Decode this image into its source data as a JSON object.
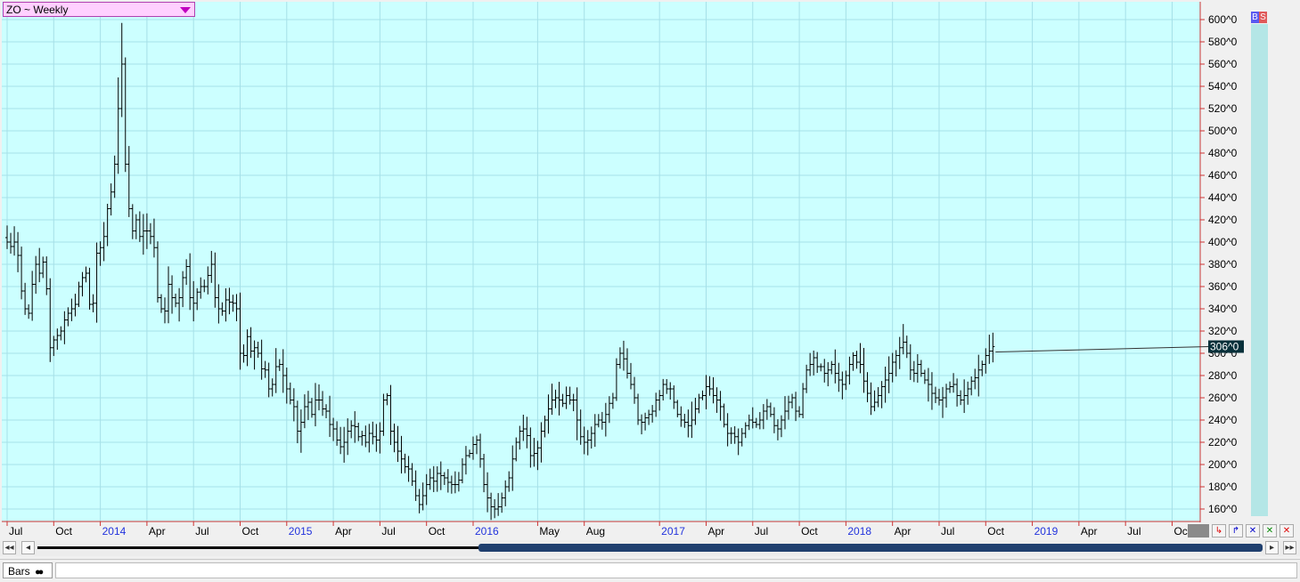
{
  "header": {
    "symbol_label": "ZO ~ Weekly"
  },
  "buttons": {
    "buy": "B",
    "sell": "S"
  },
  "bottom": {
    "study_tab": "Bars"
  },
  "colors": {
    "plot_bg": "#ccffff",
    "grid": "#a6e0e8",
    "axis": "#cc3333",
    "bar": "#000000",
    "price_tag_bg": "#08303a",
    "right_strip": "#b4e6e6",
    "year_label": "#2233dd"
  },
  "chart_data": {
    "type": "ohlc_bar",
    "title": "ZO ~ Weekly",
    "ylim": [
      150,
      610
    ],
    "y_ticks": [
      160,
      180,
      200,
      220,
      240,
      260,
      280,
      300,
      320,
      340,
      360,
      380,
      400,
      420,
      440,
      460,
      480,
      500,
      520,
      540,
      560,
      580,
      600
    ],
    "y_tick_suffix": "^0",
    "last_price_label": "306^0",
    "last_price": 306,
    "x_labels": [
      {
        "text": "Jul",
        "week": 0
      },
      {
        "text": "Oct",
        "week": 13
      },
      {
        "text": "2014",
        "week": 26,
        "year": true
      },
      {
        "text": "Apr",
        "week": 39
      },
      {
        "text": "Jul",
        "week": 52
      },
      {
        "text": "Oct",
        "week": 65
      },
      {
        "text": "2015",
        "week": 78,
        "year": true
      },
      {
        "text": "Apr",
        "week": 91
      },
      {
        "text": "Jul",
        "week": 104
      },
      {
        "text": "Oct",
        "week": 117
      },
      {
        "text": "2016",
        "week": 130,
        "year": true
      },
      {
        "text": "May",
        "week": 148
      },
      {
        "text": "Aug",
        "week": 161
      },
      {
        "text": "2017",
        "week": 182,
        "year": true
      },
      {
        "text": "Apr",
        "week": 195
      },
      {
        "text": "Jul",
        "week": 208
      },
      {
        "text": "Oct",
        "week": 221
      },
      {
        "text": "2018",
        "week": 234,
        "year": true
      },
      {
        "text": "Apr",
        "week": 247
      },
      {
        "text": "Jul",
        "week": 260
      },
      {
        "text": "Oct",
        "week": 273
      },
      {
        "text": "2019",
        "week": 286,
        "year": true
      },
      {
        "text": "Apr",
        "week": 299
      },
      {
        "text": "Jul",
        "week": 312
      },
      {
        "text": "Oct",
        "week": 325
      }
    ],
    "weekly_close": [
      400,
      396,
      400,
      388,
      356,
      340,
      336,
      362,
      380,
      372,
      382,
      358,
      305,
      312,
      316,
      320,
      330,
      336,
      340,
      344,
      360,
      368,
      372,
      344,
      345,
      390,
      395,
      405,
      430,
      445,
      470,
      520,
      560,
      470,
      430,
      410,
      420,
      405,
      410,
      410,
      405,
      395,
      350,
      340,
      338,
      362,
      350,
      345,
      350,
      368,
      378,
      350,
      345,
      355,
      360,
      360,
      370,
      380,
      350,
      340,
      338,
      348,
      346,
      345,
      340,
      300,
      298,
      315,
      302,
      305,
      300,
      286,
      285,
      268,
      272,
      288,
      290,
      280,
      268,
      258,
      252,
      230,
      238,
      252,
      256,
      245,
      258,
      258,
      250,
      248,
      236,
      232,
      222,
      216,
      220,
      230,
      235,
      234,
      225,
      226,
      220,
      228,
      225,
      222,
      230,
      258,
      262,
      230,
      220,
      212,
      205,
      198,
      196,
      185,
      172,
      164,
      172,
      182,
      188,
      185,
      192,
      190,
      188,
      184,
      182,
      182,
      186,
      200,
      208,
      210,
      218,
      222,
      205,
      182,
      170,
      162,
      160,
      162,
      170,
      180,
      188,
      205,
      220,
      230,
      232,
      226,
      208,
      210,
      215,
      230,
      240,
      250,
      258,
      260,
      258,
      255,
      262,
      258,
      258,
      240,
      225,
      220,
      222,
      228,
      236,
      240,
      238,
      245,
      255,
      260,
      290,
      300,
      295,
      282,
      272,
      260,
      240,
      238,
      242,
      245,
      248,
      258,
      262,
      272,
      268,
      268,
      256,
      245,
      240,
      238,
      235,
      240,
      250,
      260,
      262,
      270,
      268,
      262,
      258,
      252,
      236,
      228,
      228,
      225,
      220,
      228,
      235,
      240,
      238,
      236,
      240,
      248,
      252,
      245,
      235,
      232,
      240,
      248,
      256,
      260,
      248,
      245,
      268,
      285,
      290,
      296,
      288,
      288,
      282,
      285,
      290,
      282,
      276,
      272,
      280,
      290,
      298,
      292,
      290,
      275,
      264,
      252,
      256,
      262,
      270,
      276,
      282,
      292,
      298,
      305,
      310,
      300,
      285,
      282,
      290,
      282,
      276,
      272,
      264,
      260,
      258,
      260,
      268,
      270,
      272,
      262,
      258,
      262,
      268,
      275,
      278,
      285,
      290,
      298,
      302,
      306
    ]
  }
}
